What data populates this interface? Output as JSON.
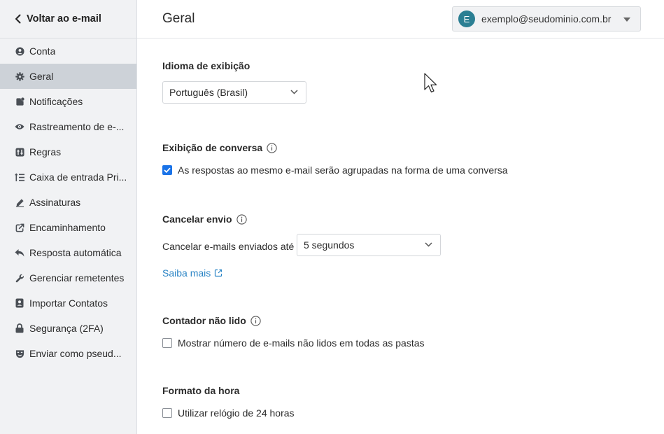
{
  "sidebar": {
    "back_label": "Voltar ao e-mail",
    "items": [
      {
        "label": "Conta",
        "icon": "user-circle-icon"
      },
      {
        "label": "Geral",
        "icon": "gear-icon"
      },
      {
        "label": "Notificações",
        "icon": "notification-icon"
      },
      {
        "label": "Rastreamento de e-...",
        "icon": "eye-icon"
      },
      {
        "label": "Regras",
        "icon": "rules-icon"
      },
      {
        "label": "Caixa de entrada Pri...",
        "icon": "priority-inbox-icon"
      },
      {
        "label": "Assinaturas",
        "icon": "pen-icon"
      },
      {
        "label": "Encaminhamento",
        "icon": "forward-icon"
      },
      {
        "label": "Resposta automática",
        "icon": "reply-icon"
      },
      {
        "label": "Gerenciar remetentes",
        "icon": "wrench-icon"
      },
      {
        "label": "Importar Contatos",
        "icon": "contacts-icon"
      },
      {
        "label": "Segurança (2FA)",
        "icon": "lock-icon"
      },
      {
        "label": "Enviar como pseud...",
        "icon": "mask-icon"
      }
    ],
    "active_index": 1
  },
  "header": {
    "title": "Geral",
    "account": {
      "avatar_letter": "E",
      "email": "exemplo@seudominio.com.br",
      "avatar_color": "#2b7f93"
    }
  },
  "sections": {
    "language": {
      "title": "Idioma de exibição",
      "value": "Português (Brasil)"
    },
    "conversation": {
      "title": "Exibição de conversa",
      "checkbox_label": "As respostas ao mesmo e-mail serão agrupadas na forma de uma conversa",
      "checked": true
    },
    "undo_send": {
      "title": "Cancelar envio",
      "label": "Cancelar e-mails enviados até",
      "value": "5 segundos",
      "link": "Saiba mais"
    },
    "unread": {
      "title": "Contador não lido",
      "checkbox_label": "Mostrar número de e-mails não lidos em todas as pastas",
      "checked": false
    },
    "time_format": {
      "title": "Formato da hora",
      "checkbox_label": "Utilizar relógio de 24 horas",
      "checked": false
    }
  },
  "colors": {
    "accent": "#1a73e8",
    "link": "#2a84c5",
    "active_bg": "#cdd2d8",
    "sidebar_bg": "#f1f2f4"
  }
}
